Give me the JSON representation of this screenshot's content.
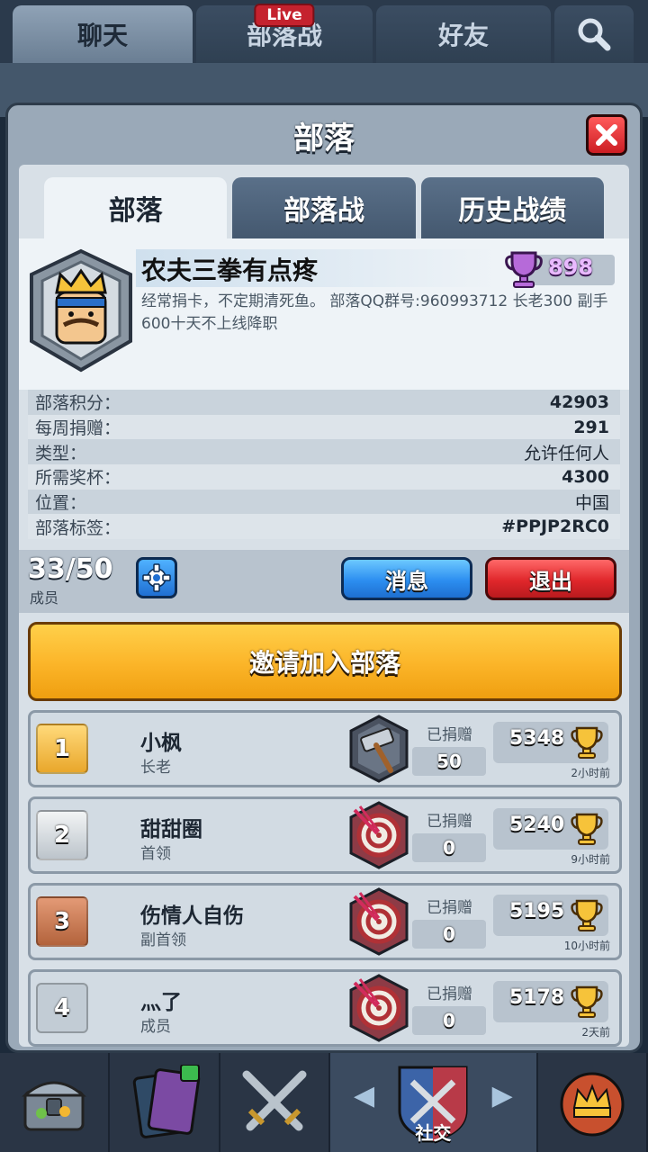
{
  "top_tabs": [
    {
      "label": "聊天",
      "active": true
    },
    {
      "label": "部落战",
      "badge": "Live"
    },
    {
      "label": "好友"
    }
  ],
  "modal": {
    "title": "部落",
    "tabs": [
      {
        "label": "部落",
        "active": true
      },
      {
        "label": "部落战"
      },
      {
        "label": "历史战绩"
      }
    ]
  },
  "clan": {
    "name": "农夫三拳有点疼",
    "trophies": "898",
    "description": "经常捐卡，不定期清死鱼。 部落QQ群号:960993712 长老300 副手600十天不上线降职"
  },
  "stats": [
    {
      "label": "部落积分：",
      "value": "42903"
    },
    {
      "label": "每周捐赠：",
      "value": "291"
    },
    {
      "label": "类型：",
      "value": "允许任何人"
    },
    {
      "label": "所需奖杯：",
      "value": "4300"
    },
    {
      "label": "位置：",
      "value": "中国"
    },
    {
      "label": "部落标签：",
      "value": "#PPJP2RC0"
    }
  ],
  "members_bar": {
    "count": "33/50",
    "label": "成员",
    "message_button": "消息",
    "leave_button": "退出"
  },
  "invite_button": "邀请加入部落",
  "donated_label": "已捐赠",
  "members": [
    {
      "rank": "1",
      "name": "小枫",
      "role": "长老",
      "donated": "50",
      "trophies": "5348",
      "last_seen": "2小时前",
      "card_icon": "hammer-card-icon"
    },
    {
      "rank": "2",
      "name": "甜甜圈",
      "role": "首领",
      "donated": "0",
      "trophies": "5240",
      "last_seen": "9小时前",
      "card_icon": "target-card-icon"
    },
    {
      "rank": "3",
      "name": "伤情人自伤",
      "role": "副首领",
      "donated": "0",
      "trophies": "5195",
      "last_seen": "10小时前",
      "card_icon": "target-card-icon"
    },
    {
      "rank": "4",
      "name": "灬了",
      "role": "成员",
      "donated": "0",
      "trophies": "5178",
      "last_seen": "2天前",
      "card_icon": "target-card-icon"
    }
  ],
  "bottom_nav": {
    "active_label": "社交"
  },
  "colors": {
    "trophy_purple": "#e9b9ff",
    "invite_gold": "#fbb428",
    "message_blue": "#2c8ef0",
    "leave_red": "#e0272b"
  }
}
